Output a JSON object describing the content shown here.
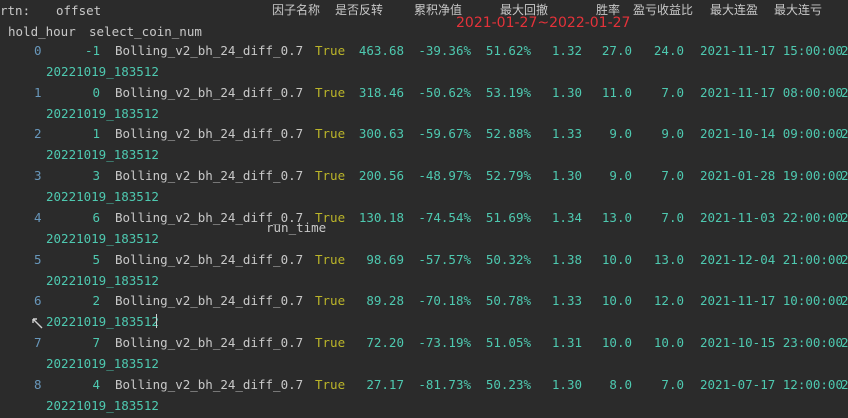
{
  "header": {
    "row1_a": "rtn:",
    "row1_b": "offset",
    "col_factor": "因子名称",
    "col_reverse": "是否反转",
    "col_netvalue": "累积净值",
    "col_drawdown": "最大回撤",
    "col_winrate": "胜率",
    "col_pl_ratio": "盈亏收益比",
    "col_max_win": "最大连盈",
    "col_max_loss": "最大连亏",
    "hold_hour": "hold_hour",
    "select_coin_num": "select_coin_num",
    "run_time": "run_time",
    "date_range": "2021-01-27~2022-01-27"
  },
  "rows": [
    {
      "index": "0",
      "coin": "-1",
      "factor": "Bolling_v2_bh_24_diff_0.7",
      "reverse": "True",
      "net": "463.68",
      "dd": "-39.36%",
      "win": "51.62%",
      "pl": "1.32",
      "maxwin": "27.0",
      "maxloss": "24.0",
      "time": "2021-11-17 15:00:00",
      "tail": "2",
      "run_time": "20221019_183512"
    },
    {
      "index": "1",
      "coin": "0",
      "factor": "Bolling_v2_bh_24_diff_0.7",
      "reverse": "True",
      "net": "318.46",
      "dd": "-50.62%",
      "win": "53.19%",
      "pl": "1.30",
      "maxwin": "11.0",
      "maxloss": "7.0",
      "time": "2021-11-17 08:00:00",
      "tail": "2",
      "run_time": "20221019_183512"
    },
    {
      "index": "2",
      "coin": "1",
      "factor": "Bolling_v2_bh_24_diff_0.7",
      "reverse": "True",
      "net": "300.63",
      "dd": "-59.67%",
      "win": "52.88%",
      "pl": "1.33",
      "maxwin": "9.0",
      "maxloss": "9.0",
      "time": "2021-10-14 09:00:00",
      "tail": "2",
      "run_time": "20221019_183512"
    },
    {
      "index": "3",
      "coin": "3",
      "factor": "Bolling_v2_bh_24_diff_0.7",
      "reverse": "True",
      "net": "200.56",
      "dd": "-48.97%",
      "win": "52.79%",
      "pl": "1.30",
      "maxwin": "9.0",
      "maxloss": "7.0",
      "time": "2021-01-28 19:00:00",
      "tail": "2",
      "run_time": "20221019_183512"
    },
    {
      "index": "4",
      "coin": "6",
      "factor": "Bolling_v2_bh_24_diff_0.7",
      "reverse": "True",
      "net": "130.18",
      "dd": "-74.54%",
      "win": "51.69%",
      "pl": "1.34",
      "maxwin": "13.0",
      "maxloss": "7.0",
      "time": "2021-11-03 22:00:00",
      "tail": "2",
      "run_time": "20221019_183512"
    },
    {
      "index": "5",
      "coin": "5",
      "factor": "Bolling_v2_bh_24_diff_0.7",
      "reverse": "True",
      "net": "98.69",
      "dd": "-57.57%",
      "win": "50.32%",
      "pl": "1.38",
      "maxwin": "10.0",
      "maxloss": "13.0",
      "time": "2021-12-04 21:00:00",
      "tail": "2",
      "run_time": "20221019_183512"
    },
    {
      "index": "6",
      "coin": "2",
      "factor": "Bolling_v2_bh_24_diff_0.7",
      "reverse": "True",
      "net": "89.28",
      "dd": "-70.18%",
      "win": "50.78%",
      "pl": "1.33",
      "maxwin": "10.0",
      "maxloss": "12.0",
      "time": "2021-11-17 10:00:00",
      "tail": "2",
      "run_time": "20221019_183512"
    },
    {
      "index": "7",
      "coin": "7",
      "factor": "Bolling_v2_bh_24_diff_0.7",
      "reverse": "True",
      "net": "72.20",
      "dd": "-73.19%",
      "win": "51.05%",
      "pl": "1.31",
      "maxwin": "10.0",
      "maxloss": "10.0",
      "time": "2021-10-15 23:00:00",
      "tail": "2",
      "run_time": "20221019_183512"
    },
    {
      "index": "8",
      "coin": "4",
      "factor": "Bolling_v2_bh_24_diff_0.7",
      "reverse": "True",
      "net": "27.17",
      "dd": "-81.73%",
      "win": "50.23%",
      "pl": "1.30",
      "maxwin": "8.0",
      "maxloss": "7.0",
      "time": "2021-07-17 12:00:00",
      "tail": "2",
      "run_time": "20221019_183512"
    }
  ],
  "colors": {
    "background": "#2b2b2b",
    "header_text": "#c8c8c8",
    "index_text": "#6897bb",
    "number_text": "#4ec9b0",
    "bool_text": "#bbb529",
    "date_range_text": "#e5323a"
  }
}
